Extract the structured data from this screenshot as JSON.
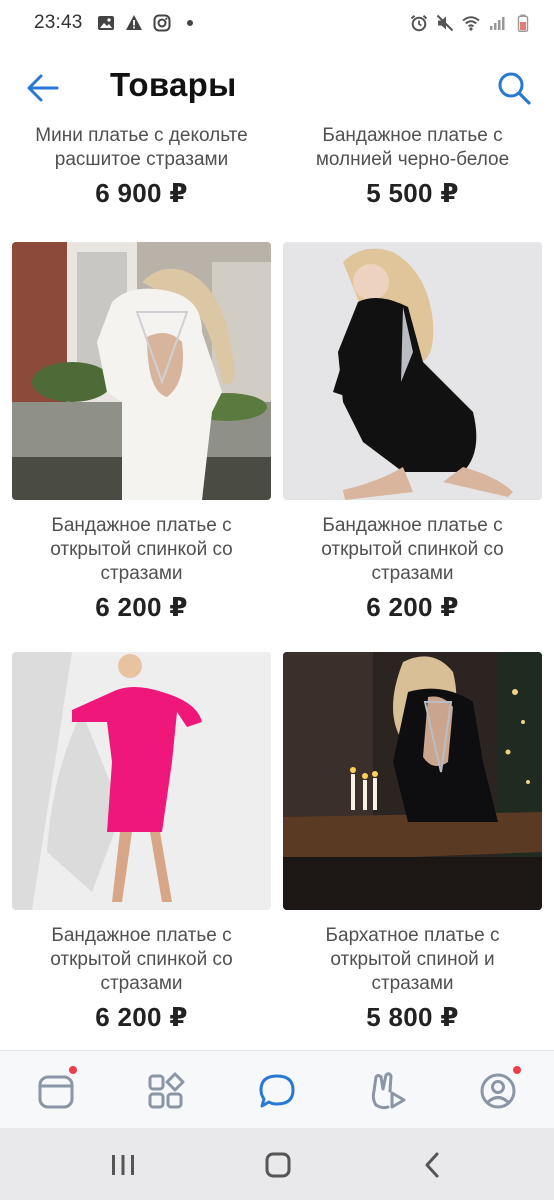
{
  "status": {
    "time": "23:43"
  },
  "header": {
    "title": "Товары"
  },
  "products": [
    {
      "title_line1": "Мини платье с декольте",
      "title_line2": "расшитое стразами",
      "title_line3": "",
      "price": "6 900 ₽"
    },
    {
      "title_line1": "Бандажное платье с",
      "title_line2": "молнией черно-белое",
      "title_line3": "",
      "price": "5 500 ₽"
    },
    {
      "title_line1": "Бандажное платье с",
      "title_line2": "открытой спинкой со",
      "title_line3": "стразами",
      "price": "6 200 ₽"
    },
    {
      "title_line1": "Бандажное платье с",
      "title_line2": "открытой спинкой со",
      "title_line3": "стразами",
      "price": "6 200 ₽"
    },
    {
      "title_line1": "Бандажное платье с",
      "title_line2": "открытой спинкой со",
      "title_line3": "стразами",
      "price": "6 200 ₽"
    },
    {
      "title_line1": "Бархатное платье с",
      "title_line2": "открытой спиной и",
      "title_line3": "стразами",
      "price": "5 800 ₽"
    }
  ],
  "bottom_nav": [
    {
      "icon": "feed-icon",
      "badge": true
    },
    {
      "icon": "services-icon",
      "badge": false
    },
    {
      "icon": "messages-icon",
      "badge": false,
      "active": true
    },
    {
      "icon": "clips-icon",
      "badge": false
    },
    {
      "icon": "profile-icon",
      "badge": true
    }
  ],
  "colors": {
    "accent": "#2a78d6",
    "badge": "#ee3d48",
    "pink_dress": "#f0177a"
  }
}
